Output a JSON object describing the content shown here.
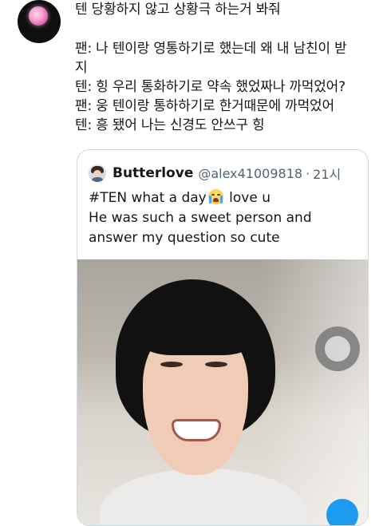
{
  "tweet": {
    "lines": [
      "텐 당황하지 않고 상황극 하는거 봐줘",
      "팬: 나 텐이랑 영통하기로 했는데 왜 내 남친이 받",
      "지",
      "텐: 힝 우리 통화하기로 약속 했었짜나 까먹었어?",
      "팬: 웅 텐이랑 통하하기로 한거때문에 까먹었어",
      "텐: 흥 됐어 나는 신경도 안쓰구 힝"
    ]
  },
  "quote": {
    "name": "Butterlove",
    "handle": "@alex41009818",
    "dot": "·",
    "time": "21시",
    "text_line1_before": "#TEN what a day",
    "emoji": "loudly-crying-face-emoji",
    "text_line1_after": " love u",
    "text_line2": "He was such a sweet person and",
    "text_line3": "answer my question so cute"
  },
  "media": {
    "type": "video-still",
    "description_icon": "camera-switch-icon"
  }
}
